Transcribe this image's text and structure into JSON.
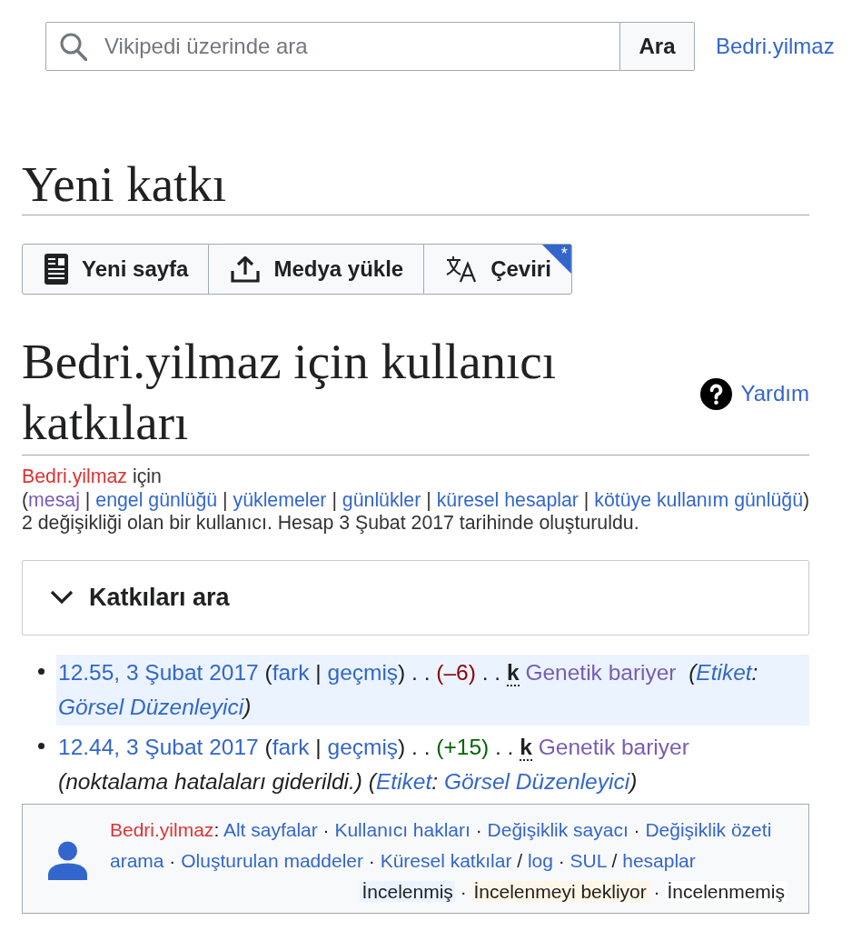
{
  "search": {
    "placeholder": "Vikipedi üzerinde ara",
    "button": "Ara"
  },
  "user_link": "Bedri.yilmaz",
  "page_title": "Yeni katkı",
  "actions": [
    {
      "kind": "article",
      "label": "Yeni sayfa"
    },
    {
      "kind": "upload",
      "label": "Medya yükle"
    },
    {
      "kind": "translate",
      "label": "Çeviri",
      "badge": "*"
    }
  ],
  "heading": "Bedri.yilmaz için kullanıcı katkıları",
  "help": "Yardım",
  "user_info": [
    [
      {
        "kind": "redlink",
        "text": "Bedri.yilmaz"
      },
      {
        "kind": "text",
        "text": " için"
      }
    ],
    [
      {
        "kind": "text",
        "text": "("
      },
      {
        "kind": "visited",
        "text": "mesaj"
      },
      {
        "kind": "text",
        "text": " | "
      },
      {
        "kind": "link",
        "text": "engel günlüğü"
      },
      {
        "kind": "text",
        "text": " | "
      },
      {
        "kind": "link",
        "text": "yüklemeler"
      },
      {
        "kind": "text",
        "text": " | "
      },
      {
        "kind": "link",
        "text": "günlükler"
      },
      {
        "kind": "text",
        "text": " | "
      },
      {
        "kind": "link",
        "text": "küresel hesaplar"
      },
      {
        "kind": "text",
        "text": " | "
      },
      {
        "kind": "link",
        "text": "kötüye kullanım günlüğü"
      },
      {
        "kind": "text",
        "text": ")"
      }
    ],
    [
      {
        "kind": "text",
        "text": "2 değişikliği olan bir kullanıcı. Hesap 3 Şubat 2017 tarihinde oluşturuldu."
      }
    ]
  ],
  "search_section": {
    "title": "Katkıları ara",
    "expanded": false
  },
  "contributions": [
    {
      "highlighted": true,
      "segments": [
        {
          "kind": "link",
          "text": "12.55, 3 Şubat 2017"
        },
        {
          "kind": "text",
          "text": " ("
        },
        {
          "kind": "link",
          "text": "fark"
        },
        {
          "kind": "text",
          "text": " | "
        },
        {
          "kind": "link",
          "text": "geçmiş"
        },
        {
          "kind": "text",
          "text": ") . . "
        },
        {
          "kind": "decrease",
          "text": "(–6)"
        },
        {
          "kind": "text",
          "text": " . . **k** "
        },
        {
          "kind": "visited",
          "text": "Genetik bariyer"
        },
        {
          "kind": "italic",
          "text": "  ("
        },
        {
          "kind": "italiclink",
          "text": "Etiket"
        },
        {
          "kind": "italic",
          "text": ": "
        },
        {
          "kind": "italiclink",
          "text": "Görsel Düzenleyici"
        },
        {
          "kind": "italic",
          "text": ")"
        }
      ]
    },
    {
      "highlighted": false,
      "segments": [
        {
          "kind": "link",
          "text": "12.44, 3 Şubat 2017"
        },
        {
          "kind": "text",
          "text": " ("
        },
        {
          "kind": "link",
          "text": "fark"
        },
        {
          "kind": "text",
          "text": " | "
        },
        {
          "kind": "link",
          "text": "geçmiş"
        },
        {
          "kind": "text",
          "text": ") . . "
        },
        {
          "kind": "increase",
          "text": "(+15)"
        },
        {
          "kind": "text",
          "text": " . . **k** "
        },
        {
          "kind": "visited",
          "text": "Genetik bariyer"
        },
        {
          "kind": "italic",
          "text": " (noktalama hatalaları giderildi.) ("
        },
        {
          "kind": "italiclink",
          "text": "Etiket"
        },
        {
          "kind": "italic",
          "text": ": "
        },
        {
          "kind": "italiclink",
          "text": "Görsel Düzenleyici"
        },
        {
          "kind": "italic",
          "text": ")"
        }
      ]
    }
  ],
  "tools": {
    "lines": [
      [
        {
          "kind": "redlink",
          "text": "Bedri.yilmaz"
        },
        {
          "kind": "text",
          "text": ": "
        },
        {
          "kind": "link",
          "text": "Alt sayfalar"
        },
        {
          "kind": "text",
          "text": " · "
        },
        {
          "kind": "link",
          "text": "Kullanıcı hakları"
        },
        {
          "kind": "text",
          "text": " · "
        },
        {
          "kind": "link",
          "text": "Değişiklik sayacı"
        },
        {
          "kind": "text",
          "text": " · "
        },
        {
          "kind": "link",
          "text": "Değişiklik özeti"
        }
      ],
      [
        {
          "kind": "link",
          "text": "arama"
        },
        {
          "kind": "text",
          "text": " · "
        },
        {
          "kind": "link",
          "text": "Oluşturulan maddeler"
        },
        {
          "kind": "text",
          "text": " · "
        },
        {
          "kind": "link",
          "text": "Küresel katkılar"
        },
        {
          "kind": "text",
          "text": " / "
        },
        {
          "kind": "link",
          "text": "log"
        },
        {
          "kind": "text",
          "text": " · "
        },
        {
          "kind": "link",
          "text": "SUL"
        },
        {
          "kind": "text",
          "text": " / "
        },
        {
          "kind": "link",
          "text": "hesaplar"
        }
      ]
    ],
    "legend": [
      {
        "kind": "label",
        "text": "İncelenmiş",
        "color": "#eaf3ff"
      },
      {
        "kind": "text",
        "text": " · "
      },
      {
        "kind": "label",
        "text": "İncelenmeyi bekliyor",
        "color": "#fef6e7"
      },
      {
        "kind": "text",
        "text": " · "
      },
      {
        "kind": "label",
        "text": "İncelenmemiş",
        "color": "#ffffff"
      }
    ]
  }
}
